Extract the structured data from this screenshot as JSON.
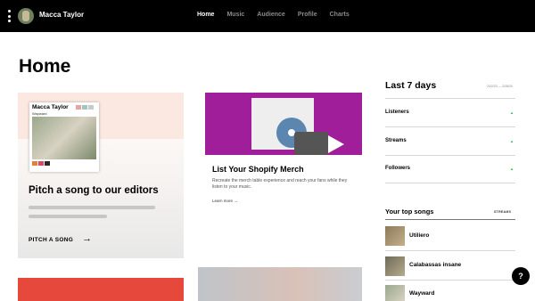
{
  "header": {
    "artist_name": "Macca Taylor",
    "nav": [
      "Home",
      "Music",
      "Audience",
      "Profile",
      "Charts"
    ],
    "active": "Home"
  },
  "page": {
    "title": "Home"
  },
  "pitch_card": {
    "mini_name": "Macca Taylor",
    "mini_song": "Wayward",
    "title": "Pitch a song to our editors",
    "cta": "PITCH A SONG"
  },
  "merch_card": {
    "title": "List Your Shopify Merch",
    "description": "Recreate the merch table experience and reach your fans while they listen to your music.",
    "link": "Learn more"
  },
  "stats": {
    "title": "Last 7 days",
    "date_range": "2/22/20 — 2/28/20",
    "items": [
      {
        "label": "Listeners"
      },
      {
        "label": "Streams"
      },
      {
        "label": "Followers"
      }
    ]
  },
  "top_songs": {
    "title": "Your top songs",
    "column": "STREAMS",
    "items": [
      {
        "name": "Utiliero"
      },
      {
        "name": "Calabassas insane"
      },
      {
        "name": "Wayward"
      }
    ]
  },
  "help": {
    "label": "?"
  },
  "colors": {
    "nav_bg": "#000000",
    "accent_green": "#1db954",
    "merch_purple": "#a11e9a",
    "red_card": "#e7483c"
  }
}
